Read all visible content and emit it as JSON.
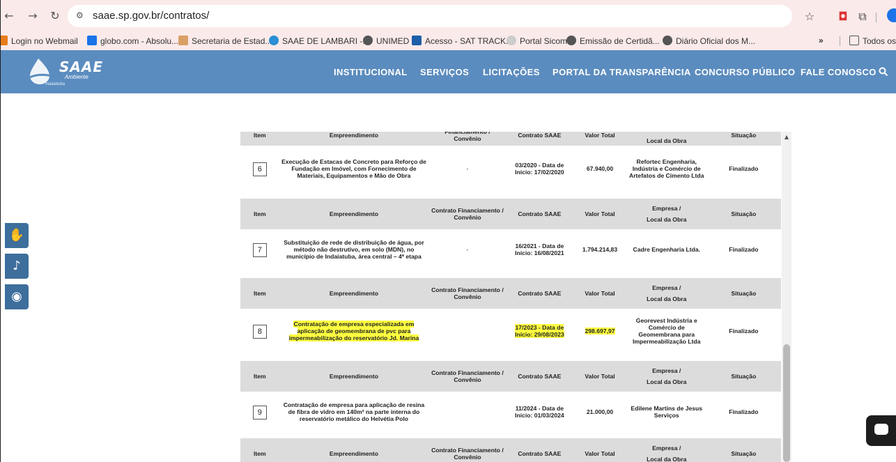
{
  "browser": {
    "url": "saae.sp.gov.br/contratos/",
    "nav_icons": [
      "back-arrow-icon",
      "forward-arrow-icon",
      "reload-icon",
      "site-settings-icon"
    ],
    "bookmarks": [
      {
        "label": "Login no Webmail",
        "color": "#e87b1a"
      },
      {
        "label": "globo.com - Absolu...",
        "color": "#1a73e8"
      },
      {
        "label": "Secretaria de Estad...",
        "color": "#d9a066"
      },
      {
        "label": "SAAE DE LAMBARI -...",
        "color": "#2a8fd4"
      },
      {
        "label": "UNIMED",
        "color": "#555555"
      },
      {
        "label": "Acesso - SAT TRACK...",
        "color": "#1d5fa8"
      },
      {
        "label": "Portal Sicom",
        "color": "#bbbbbb"
      },
      {
        "label": "Emissão de Certidã...",
        "color": "#555555"
      },
      {
        "label": "Diário Oficial dos M...",
        "color": "#555555"
      }
    ],
    "overflow": "»",
    "all_bookmarks": "Todos os fa"
  },
  "site": {
    "logo_text": "SAAE",
    "logo_sub": "Ambiente",
    "logo_city": "Indaiatuba",
    "nav": [
      "INSTITUCIONAL",
      "SERVIÇOS",
      "LICITAÇÕES",
      "PORTAL DA TRANSPARÊNCIA",
      "CONCURSO PÚBLICO",
      "FALE CONOSCO"
    ]
  },
  "table": {
    "headers": {
      "item": "Item",
      "empreendimento": "Empreendimento",
      "contrato_fin": "Contrato Financiamento / Convênio",
      "contrato_saae": "Contrato SAAE",
      "valor": "Valor Total",
      "empresa": "Empresa /",
      "local": "Local da Obra",
      "situacao": "Situação"
    },
    "partial_header": {
      "item": "Item",
      "empreendimento": "Empreendimento",
      "contrato_fin": "Financiamento / Convênio",
      "contrato_saae": "Contrato SAAE",
      "valor": "Valor Total",
      "local": "Local da Obra",
      "situacao": "Situação"
    },
    "rows": [
      {
        "item": "6",
        "empreendimento": "Execução de Estacas de Concreto para Reforço de Fundação em Imóvel, com Fornecimento de Materiais, Equipamentos e Mão de Obra",
        "contrato_fin": "-",
        "contrato_saae": "03/2020 - Data de Início: 17/02/2020",
        "valor": "67.940,00",
        "empresa": "Refortec Engenharia, Indústria e Comércio de Artefatos de Cimento Ltda",
        "situacao": "Finalizado"
      },
      {
        "item": "7",
        "empreendimento": "Substituição de rede de distribuição de água, por método não destrutivo, em solo (MDN), no município de Indaiatuba, área central – 4ª etapa",
        "contrato_fin": "-",
        "contrato_saae": "16/2021 - Data de Início: 16/08/2021",
        "valor": "1.794.214,83",
        "empresa": "Cadre Engenharia Ltda.",
        "situacao": "Finalizado"
      },
      {
        "item": "8",
        "empreendimento": "Contratação de empresa especializada em aplicação de geomembrana de pvc para impermeabilização do reservatório Jd. Marina",
        "contrato_fin": "",
        "contrato_saae": "17/2023 - Data de Início: 29/08/2023",
        "valor": "298.697,97",
        "empresa": "Georevest Indústria e Comércio de Geomembrana para Impermeabilização Ltda",
        "situacao": "Finalizado"
      },
      {
        "item": "9",
        "empreendimento": "Contratação de empresa para aplicação de resina de fibra de vidro em 140m² na parte interna do reservatório metálico do Helvétia Polo",
        "contrato_fin": "",
        "contrato_saae": "11/2024 - Data de Início: 01/03/2024",
        "valor": "21.000,00",
        "empresa": "Edilene Martins de Jesus Serviços",
        "situacao": "Finalizado"
      }
    ]
  },
  "accessibility": [
    "sign-language-icon",
    "audio-reader-icon",
    "high-contrast-icon"
  ],
  "colors": {
    "header_blue": "#5b8cbf",
    "highlight": "#ffff40",
    "table_header": "#dcdcdc"
  }
}
